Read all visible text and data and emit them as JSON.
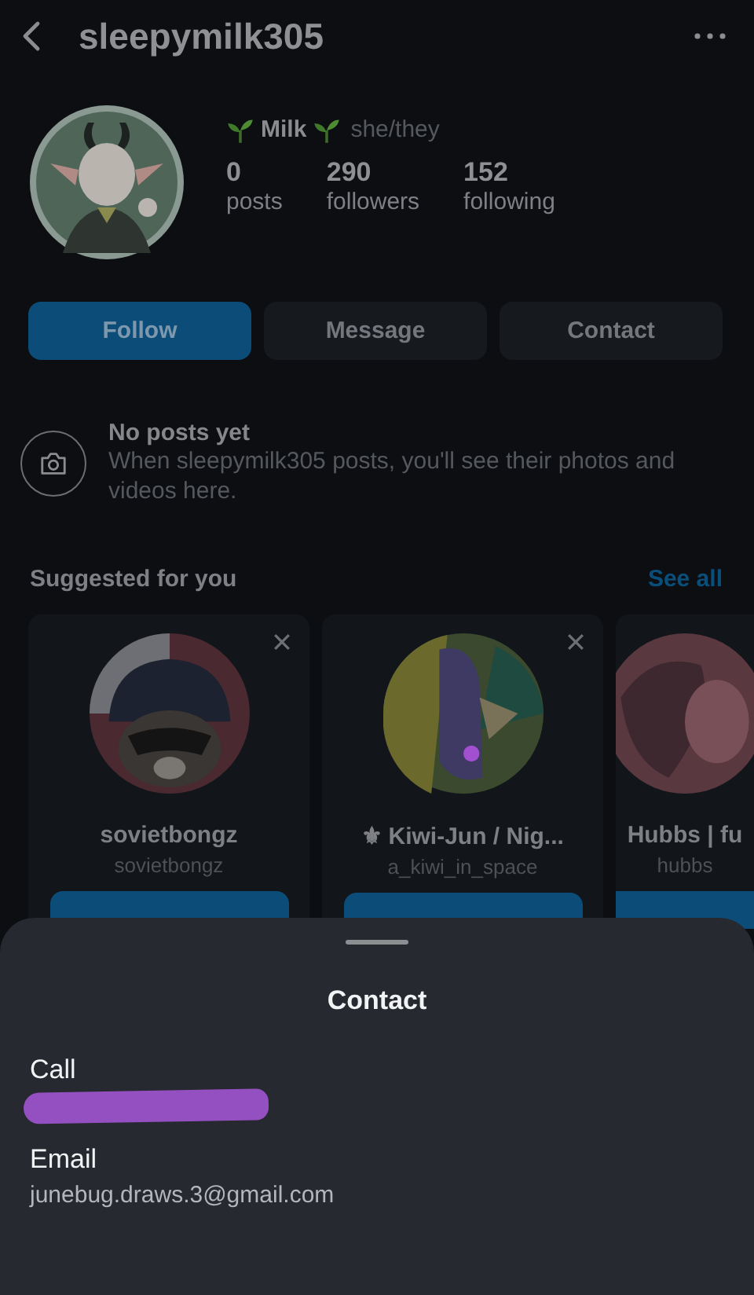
{
  "header": {
    "username": "sleepymilk305"
  },
  "profile": {
    "display_name": "Milk",
    "pronouns": "she/they",
    "stats": [
      {
        "value": "0",
        "label": "posts"
      },
      {
        "value": "290",
        "label": "followers"
      },
      {
        "value": "152",
        "label": "following"
      }
    ]
  },
  "actions": [
    {
      "label": "Follow",
      "kind": "primary"
    },
    {
      "label": "Message",
      "kind": "secondary"
    },
    {
      "label": "Contact",
      "kind": "secondary"
    }
  ],
  "empty_state": {
    "title": "No posts yet",
    "text": "When sleepymilk305 posts, you'll see their photos and videos here."
  },
  "suggested": {
    "title": "Suggested for you",
    "see_all": "See all",
    "cards": [
      {
        "name": "sovietbongz",
        "handle": "sovietbongz",
        "dismissable": true
      },
      {
        "name": "⚜ Kiwi-Jun / Nig...",
        "handle": "a_kiwi_in_space",
        "dismissable": true
      },
      {
        "name": "Hubbs | fu",
        "handle": "hubbs",
        "dismissable": false
      }
    ]
  },
  "sheet": {
    "title": "Contact",
    "items": [
      {
        "label": "Call",
        "kind": "redacted"
      },
      {
        "label": "Email",
        "kind": "text",
        "value": "junebug.draws.3@gmail.com"
      }
    ]
  }
}
